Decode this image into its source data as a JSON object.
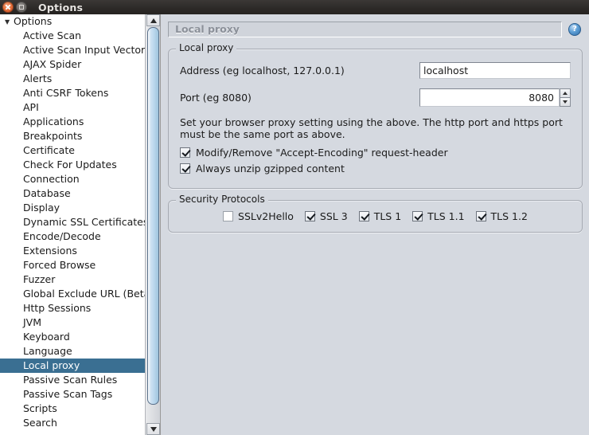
{
  "window": {
    "title": "Options",
    "close_icon": "close-icon",
    "maximize_icon": "maximize-icon"
  },
  "sidebar": {
    "root": {
      "label": "Options",
      "twisty": "▼"
    },
    "items": [
      {
        "label": "Active Scan",
        "selected": false
      },
      {
        "label": "Active Scan Input Vector",
        "selected": false
      },
      {
        "label": "AJAX Spider",
        "selected": false
      },
      {
        "label": "Alerts",
        "selected": false
      },
      {
        "label": "Anti CSRF Tokens",
        "selected": false
      },
      {
        "label": "API",
        "selected": false
      },
      {
        "label": "Applications",
        "selected": false
      },
      {
        "label": "Breakpoints",
        "selected": false
      },
      {
        "label": "Certificate",
        "selected": false
      },
      {
        "label": "Check For Updates",
        "selected": false
      },
      {
        "label": "Connection",
        "selected": false
      },
      {
        "label": "Database",
        "selected": false
      },
      {
        "label": "Display",
        "selected": false
      },
      {
        "label": "Dynamic SSL Certificates",
        "selected": false
      },
      {
        "label": "Encode/Decode",
        "selected": false
      },
      {
        "label": "Extensions",
        "selected": false
      },
      {
        "label": "Forced Browse",
        "selected": false
      },
      {
        "label": "Fuzzer",
        "selected": false
      },
      {
        "label": "Global Exclude URL (Beta)",
        "selected": false
      },
      {
        "label": "Http Sessions",
        "selected": false
      },
      {
        "label": "JVM",
        "selected": false
      },
      {
        "label": "Keyboard",
        "selected": false
      },
      {
        "label": "Language",
        "selected": false
      },
      {
        "label": "Local proxy",
        "selected": true
      },
      {
        "label": "Passive Scan Rules",
        "selected": false
      },
      {
        "label": "Passive Scan Tags",
        "selected": false
      },
      {
        "label": "Scripts",
        "selected": false
      },
      {
        "label": "Search",
        "selected": false
      }
    ],
    "selection_color": "#3a6f92",
    "scrollbar": {
      "up_arrow": "scroll-up-arrow",
      "down_arrow": "scroll-down-arrow"
    }
  },
  "panel": {
    "header_title": "Local proxy",
    "help_icon_label": "?",
    "local_proxy_group": {
      "title": "Local proxy",
      "address_label": "Address (eg localhost, 127.0.0.1)",
      "address_value": "localhost",
      "address_placeholder": "localhost",
      "port_label": "Port (eg 8080)",
      "port_value": "8080",
      "port_placeholder": "8080",
      "description": "Set your browser proxy setting using the above. The http port and https port must be the same port as above.",
      "checkboxes": [
        {
          "label": "Modify/Remove \"Accept-Encoding\" request-header",
          "checked": true
        },
        {
          "label": "Always unzip gzipped content",
          "checked": true
        }
      ]
    },
    "security_protocols_group": {
      "title": "Security Protocols",
      "protocols": [
        {
          "label": "SSLv2Hello",
          "checked": false
        },
        {
          "label": "SSL 3",
          "checked": true
        },
        {
          "label": "TLS 1",
          "checked": true
        },
        {
          "label": "TLS 1.1",
          "checked": true
        },
        {
          "label": "TLS 1.2",
          "checked": true
        }
      ]
    }
  }
}
